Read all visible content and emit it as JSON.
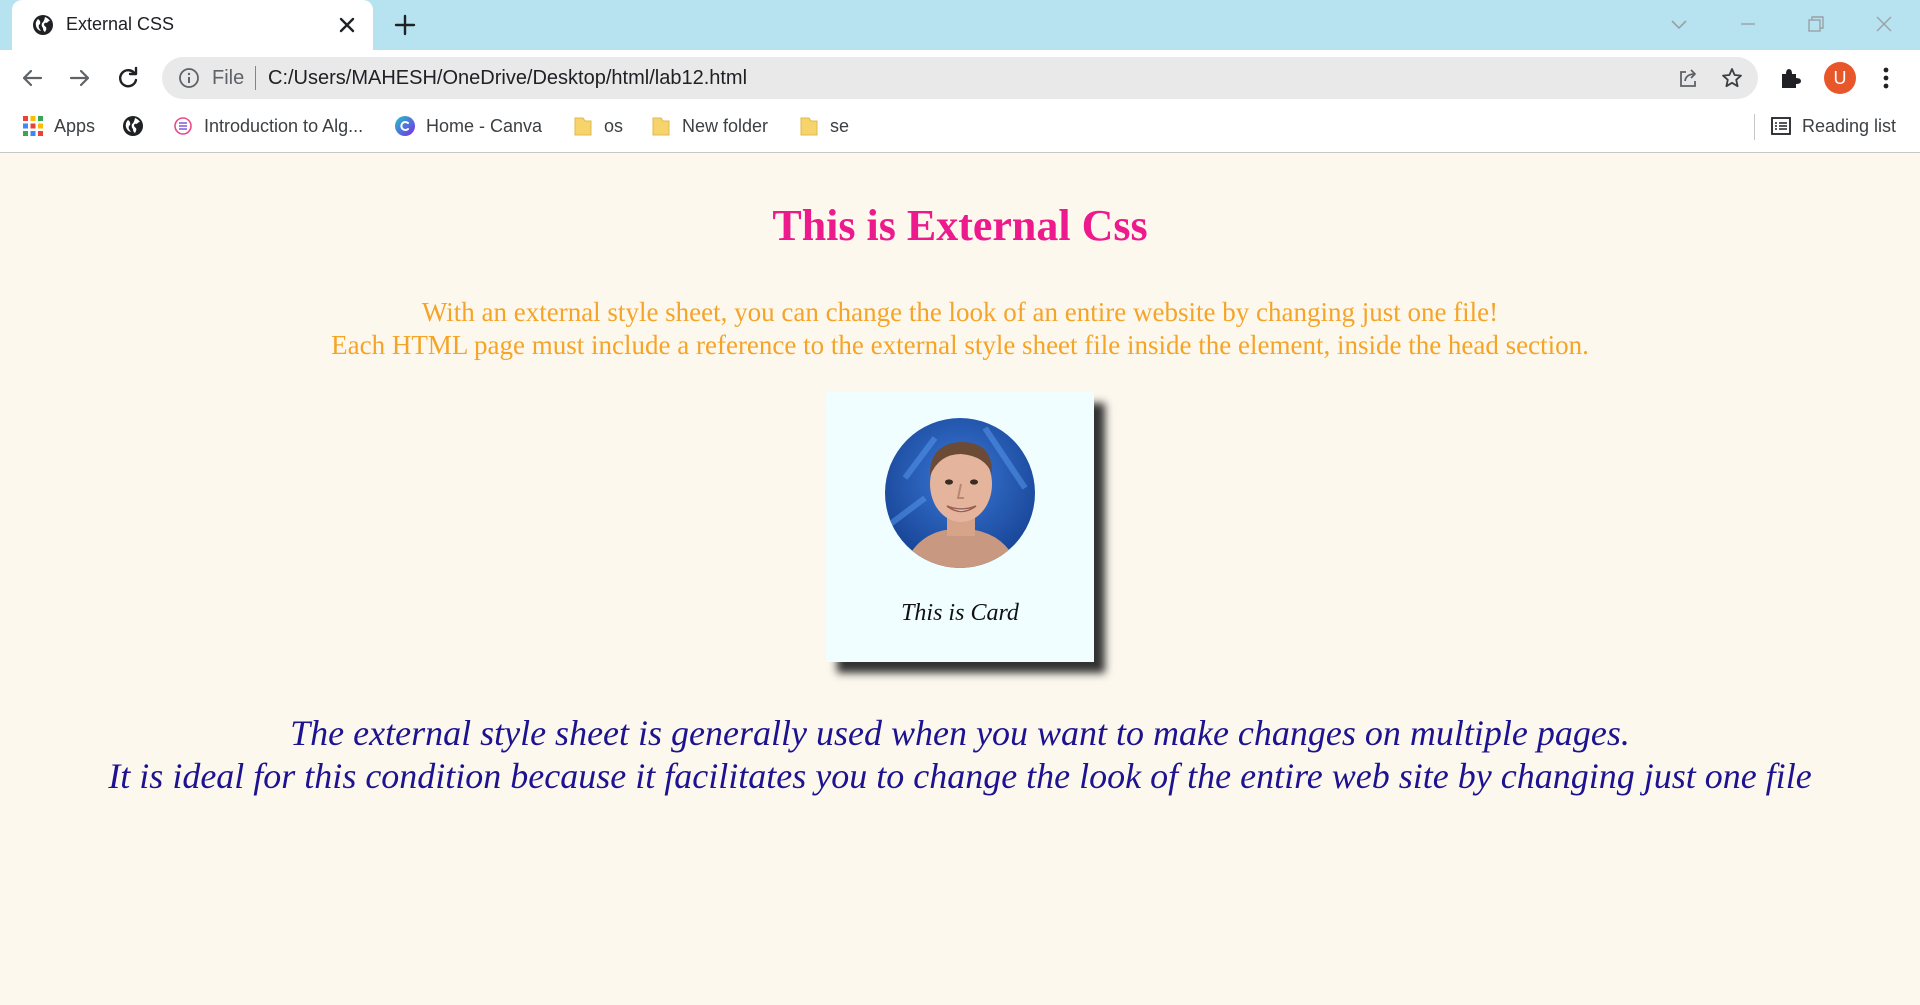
{
  "browser": {
    "tab": {
      "title": "External CSS"
    },
    "address": {
      "scheme_label": "File",
      "url": "C:/Users/MAHESH/OneDrive/Desktop/html/lab12.html"
    },
    "profile_initial": "U",
    "bookmarks": [
      {
        "label": "Apps",
        "icon": "apps-grid-icon"
      },
      {
        "label": "",
        "icon": "globe-icon"
      },
      {
        "label": "Introduction to Alg...",
        "icon": "site-icon"
      },
      {
        "label": "Home - Canva",
        "icon": "canva-icon"
      },
      {
        "label": "os",
        "icon": "folder-icon"
      },
      {
        "label": "New folder",
        "icon": "folder-icon"
      },
      {
        "label": "se",
        "icon": "folder-icon"
      }
    ],
    "reading_list": "Reading list"
  },
  "content": {
    "heading": "This is External Css",
    "paragraph_line1": "With an external style sheet, you can change the look of an entire website by changing just one file!",
    "paragraph_line2": "Each HTML page must include a reference to the external style sheet file inside the element, inside the head section.",
    "card_caption": "This is Card",
    "note_line1": "The external style sheet is generally used when you want to make changes on multiple pages.",
    "note_line2": "It is ideal for this condition because it facilitates you to change the look of the entire web site by changing just one file"
  },
  "colors": {
    "heading": "#ec1a8c",
    "paragraph": "#f5a428",
    "note": "#1d1390",
    "page_background": "#fdf8ee",
    "card_background": "#f0feff",
    "tabstrip": "#b7e3f1"
  }
}
